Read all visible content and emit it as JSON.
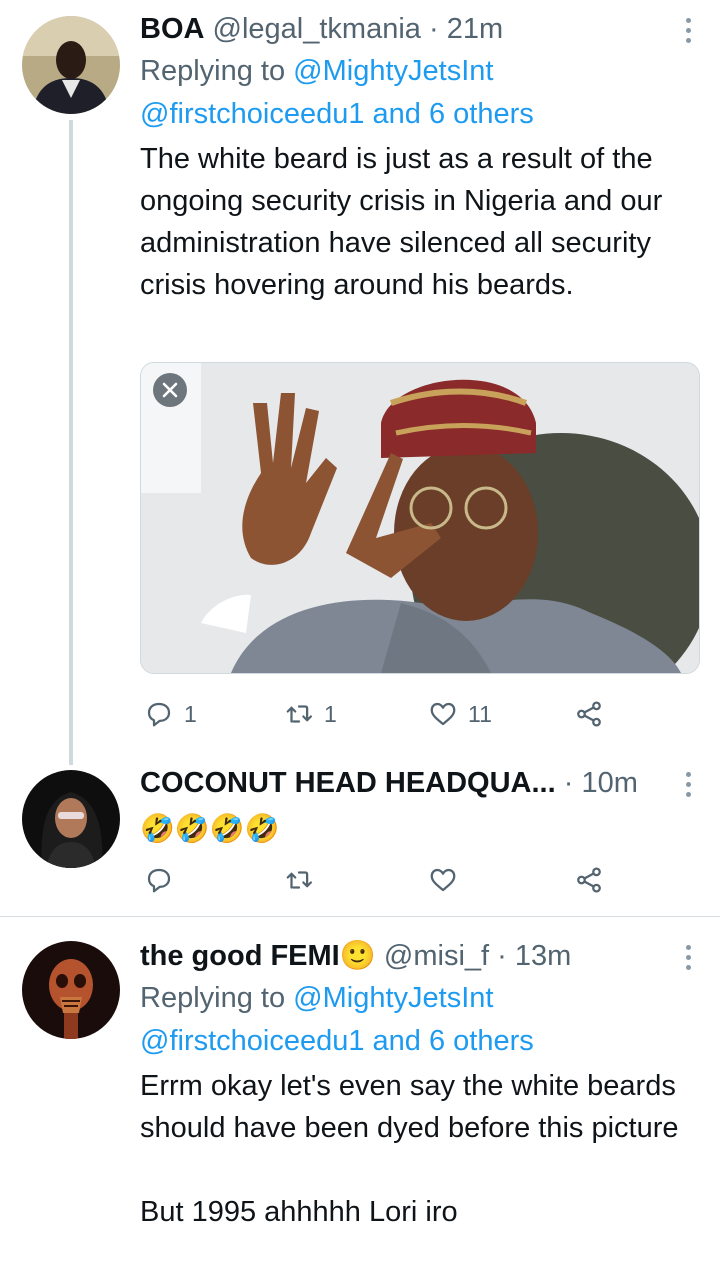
{
  "tweets": [
    {
      "name": "BOA",
      "handle": "@legal_tkmania",
      "time": "21m",
      "reply_prefix": "Replying to",
      "reply_user": "@MightyJetsInt",
      "reply_more": "@firstchoiceedu1 and 6 others",
      "text": "The white beard is just as a result of the ongoing security crisis in Nigeria and our administration have silenced all security crisis hovering around his beards.",
      "counts": {
        "reply": "1",
        "retweet": "1",
        "like": "11"
      }
    },
    {
      "name": "COCONUT HEAD HEADQUA...",
      "time": "10m",
      "emoji_text": "🤣🤣🤣🤣"
    },
    {
      "name": "the good FEMI🙂",
      "handle": "@misi_f",
      "time": "13m",
      "reply_prefix": "Replying to",
      "reply_user": "@MightyJetsInt",
      "reply_more": "@firstchoiceedu1 and 6 others",
      "text_1": "Errm okay let's even say the white beards should have been dyed before this picture",
      "text_2": "But 1995 ahhhhh Lori iro"
    }
  ],
  "colors": {
    "link": "#1d9bf0",
    "secondary": "#536471",
    "primary_text": "#0f1419",
    "thread_line": "#cfd9de"
  },
  "icons": [
    "reply-icon",
    "retweet-icon",
    "like-icon",
    "share-icon",
    "more-icon",
    "close-icon"
  ]
}
